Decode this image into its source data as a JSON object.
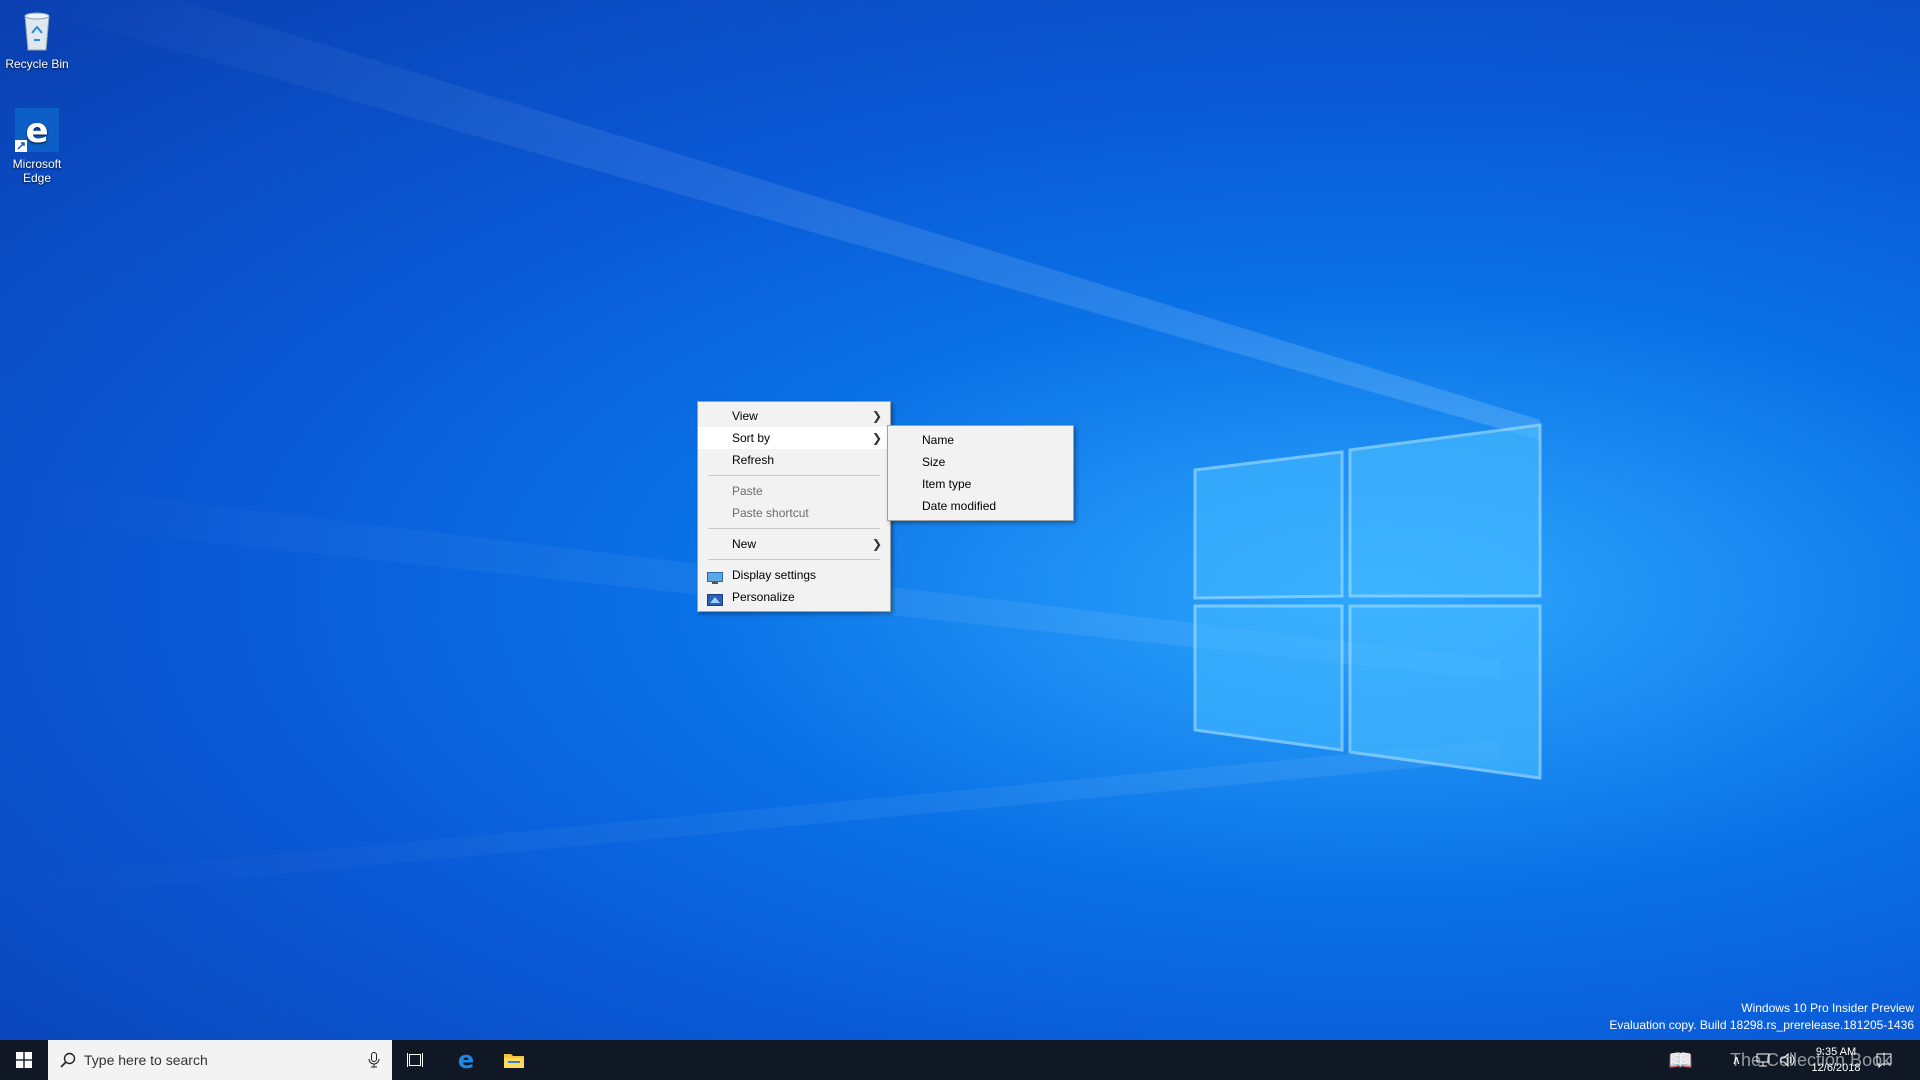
{
  "desktop": {
    "icons": [
      {
        "label": "Recycle Bin",
        "icon": "recycle-bin-icon"
      },
      {
        "label": "Microsoft Edge",
        "icon": "edge-icon"
      }
    ]
  },
  "context_menu": {
    "items": [
      {
        "label": "View",
        "has_submenu": true
      },
      {
        "label": "Sort by",
        "has_submenu": true,
        "highlighted": true
      },
      {
        "label": "Refresh"
      },
      {
        "label": "Paste",
        "disabled": true
      },
      {
        "label": "Paste shortcut",
        "disabled": true
      },
      {
        "label": "New",
        "has_submenu": true
      },
      {
        "label": "Display settings",
        "icon": "display-settings-icon"
      },
      {
        "label": "Personalize",
        "icon": "personalize-icon"
      }
    ]
  },
  "sort_submenu": {
    "items": [
      {
        "label": "Name"
      },
      {
        "label": "Size"
      },
      {
        "label": "Item type"
      },
      {
        "label": "Date modified"
      }
    ]
  },
  "watermark": {
    "line1": "Windows 10 Pro Insider Preview",
    "line2": "Evaluation copy. Build 18298.rs_prerelease.181205-1436"
  },
  "taskbar": {
    "search_placeholder": "Type here to search",
    "clock_time": "9:35 AM",
    "clock_date": "12/6/2018",
    "overlay_text": "The Collection Book"
  },
  "colors": {
    "taskbar": "#101826",
    "menu_bg": "#f2f2f2",
    "accent": "#0078d7"
  }
}
